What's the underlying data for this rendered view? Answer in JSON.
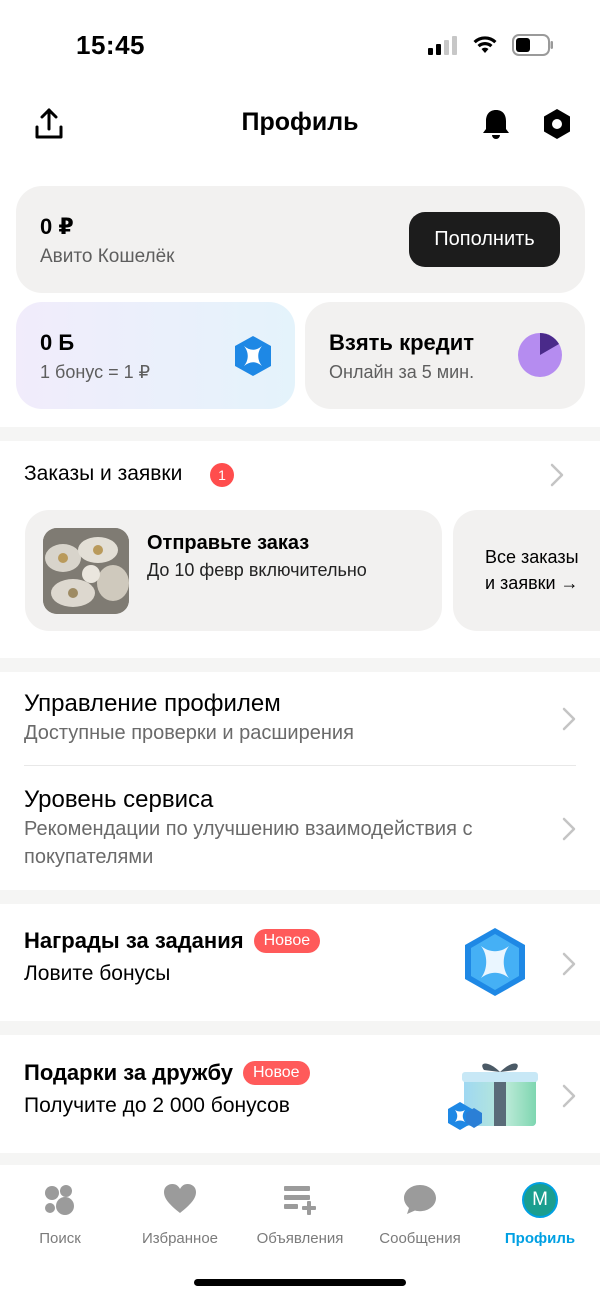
{
  "status": {
    "time": "15:45"
  },
  "header": {
    "title": "Профиль"
  },
  "wallet": {
    "amount": "0 ₽",
    "label": "Авито Кошелёк",
    "topup_label": "Пополнить"
  },
  "bonus": {
    "amount": "0 Б",
    "rate": "1 бонус = 1 ₽"
  },
  "credit": {
    "title": "Взять кредит",
    "subtitle": "Онлайн за 5 мин."
  },
  "orders": {
    "label": "Заказы и заявки",
    "badge": "1",
    "card_title": "Отправьте заказ",
    "card_subtitle": "До 10 февр включительно",
    "all_line1": "Все заказы",
    "all_line2": "и заявки →"
  },
  "menu": [
    {
      "title": "Управление профилем",
      "subtitle": "Доступные проверки и расширения"
    },
    {
      "title": "Уровень сервиса",
      "subtitle": "Рекомендации по улучшению взаимодействия с покупателями"
    }
  ],
  "promos": [
    {
      "title": "Награды за задания",
      "badge": "Новое",
      "subtitle": "Ловите бонусы"
    },
    {
      "title": "Подарки за дружбу",
      "badge": "Новое",
      "subtitle": "Получите до 2 000 бонусов"
    }
  ],
  "tabs": [
    {
      "label": "Поиск",
      "icon": "search-dots-icon"
    },
    {
      "label": "Избранное",
      "icon": "heart-icon"
    },
    {
      "label": "Объявления",
      "icon": "add-listing-icon"
    },
    {
      "label": "Сообщения",
      "icon": "chat-bubble-icon"
    },
    {
      "label": "Профиль",
      "icon": "avatar-icon",
      "avatar_letter": "М",
      "active": true
    }
  ],
  "colors": {
    "accent": "#00a0e3",
    "badge_red": "#ff5a5a",
    "avatar_bg": "#1a9e8f"
  }
}
